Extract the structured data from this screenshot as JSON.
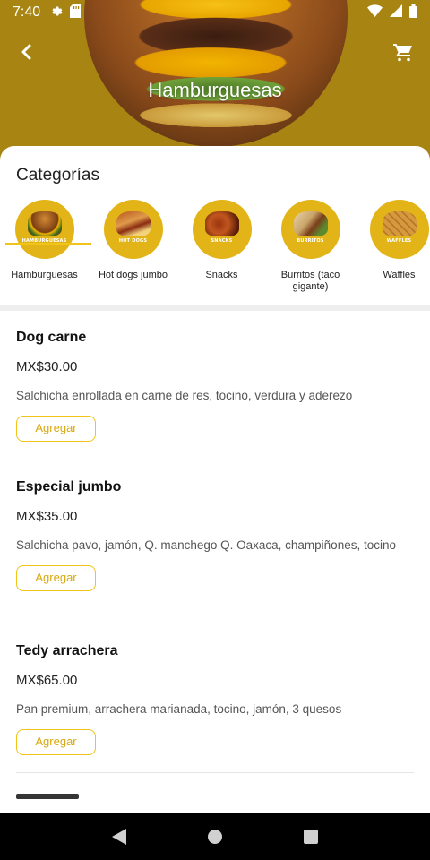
{
  "status_bar": {
    "time": "7:40",
    "left_icons": [
      "settings-icon",
      "sd-card-icon"
    ],
    "right_icons": [
      "wifi-icon",
      "signal-icon",
      "battery-icon"
    ]
  },
  "header": {
    "title": "Hamburguesas",
    "back_icon": "back-chevron-icon",
    "cart_icon": "cart-icon"
  },
  "categories": {
    "heading": "Categorías",
    "selected_index": 0,
    "items": [
      {
        "label": "Hamburguesas",
        "badge": "HAMBURGUESAS"
      },
      {
        "label": "Hot dogs jumbo",
        "badge": "HOT DOGS"
      },
      {
        "label": "Snacks",
        "badge": "SNACKS"
      },
      {
        "label": "Burritos (taco gigante)",
        "badge": "BURRITOS"
      },
      {
        "label": "Waffles",
        "badge": "WAFFLES"
      }
    ]
  },
  "products": [
    {
      "name": "Dog carne",
      "price": "MX$30.00",
      "description": "Salchicha enrollada en carne de res, tocino, verdura y aderezo",
      "button": "Agregar"
    },
    {
      "name": "Especial jumbo",
      "price": "MX$35.00",
      "description": "Salchicha pavo, jamón, Q. manchego Q. Oaxaca, champiñones, tocino",
      "button": "Agregar"
    },
    {
      "name": "Tedy arrachera",
      "price": "MX$65.00",
      "description": "Pan premium, arrachera marianada, tocino, jamón, 3 quesos",
      "button": "Agregar"
    }
  ],
  "nav_bar": {
    "buttons": [
      "back-triangle-icon",
      "home-circle-icon",
      "recents-square-icon"
    ]
  },
  "colors": {
    "accent": "#f0c419",
    "hero_bg": "#a88512",
    "category_circle": "#e2b418"
  }
}
